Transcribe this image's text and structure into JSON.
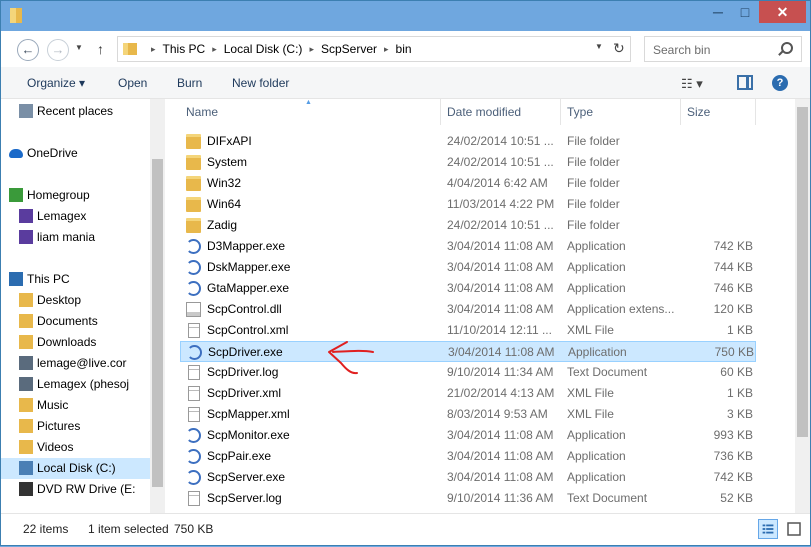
{
  "window": {
    "controls": {
      "minimize": "─",
      "maximize": "□",
      "close": "✕"
    }
  },
  "address": {
    "crumbs": [
      "This PC",
      "Local Disk (C:)",
      "ScpServer",
      "bin"
    ],
    "search_placeholder": "Search bin"
  },
  "toolbar": {
    "organize": "Organize ▾",
    "open": "Open",
    "burn": "Burn",
    "new_folder": "New folder",
    "view_options": "☷ ▾",
    "help": "?"
  },
  "nav": {
    "items": [
      {
        "label": "Recent places",
        "icon": "recent-places-icon"
      },
      {
        "label": "OneDrive",
        "icon": "onedrive-icon"
      },
      {
        "label": "Homegroup",
        "icon": "homegroup-icon"
      },
      {
        "label": "Lemagex",
        "icon": "user-icon"
      },
      {
        "label": "liam mania",
        "icon": "user-icon"
      },
      {
        "label": "This PC",
        "icon": "computer-icon"
      },
      {
        "label": "Desktop",
        "icon": "folder-icon"
      },
      {
        "label": "Documents",
        "icon": "folder-icon"
      },
      {
        "label": "Downloads",
        "icon": "folder-icon"
      },
      {
        "label": "lemage@live.cor",
        "icon": "network-pc-icon"
      },
      {
        "label": "Lemagex (phesoj",
        "icon": "network-pc-icon"
      },
      {
        "label": "Music",
        "icon": "folder-icon"
      },
      {
        "label": "Pictures",
        "icon": "folder-icon"
      },
      {
        "label": "Videos",
        "icon": "folder-icon"
      },
      {
        "label": "Local Disk (C:)",
        "icon": "drive-icon"
      },
      {
        "label": "DVD RW Drive (E:",
        "icon": "dvd-drive-icon"
      }
    ]
  },
  "columns": {
    "name": "Name",
    "date": "Date modified",
    "type": "Type",
    "size": "Size"
  },
  "files": [
    {
      "name": "DIFxAPI",
      "date": "24/02/2014 10:51 ...",
      "type": "File folder",
      "size": "",
      "icon": "folder"
    },
    {
      "name": "System",
      "date": "24/02/2014 10:51 ...",
      "type": "File folder",
      "size": "",
      "icon": "folder"
    },
    {
      "name": "Win32",
      "date": "4/04/2014 6:42 AM",
      "type": "File folder",
      "size": "",
      "icon": "folder"
    },
    {
      "name": "Win64",
      "date": "11/03/2014 4:22 PM",
      "type": "File folder",
      "size": "",
      "icon": "folder"
    },
    {
      "name": "Zadig",
      "date": "24/02/2014 10:51 ...",
      "type": "File folder",
      "size": "",
      "icon": "folder"
    },
    {
      "name": "D3Mapper.exe",
      "date": "3/04/2014 11:08 AM",
      "type": "Application",
      "size": "742 KB",
      "icon": "exe"
    },
    {
      "name": "DskMapper.exe",
      "date": "3/04/2014 11:08 AM",
      "type": "Application",
      "size": "744 KB",
      "icon": "exe"
    },
    {
      "name": "GtaMapper.exe",
      "date": "3/04/2014 11:08 AM",
      "type": "Application",
      "size": "746 KB",
      "icon": "exe"
    },
    {
      "name": "ScpControl.dll",
      "date": "3/04/2014 11:08 AM",
      "type": "Application extens...",
      "size": "120 KB",
      "icon": "dll"
    },
    {
      "name": "ScpControl.xml",
      "date": "11/10/2014 12:11 ...",
      "type": "XML File",
      "size": "1 KB",
      "icon": "doc"
    },
    {
      "name": "ScpDriver.exe",
      "date": "3/04/2014 11:08 AM",
      "type": "Application",
      "size": "750 KB",
      "icon": "exe",
      "selected": true
    },
    {
      "name": "ScpDriver.log",
      "date": "9/10/2014 11:34 AM",
      "type": "Text Document",
      "size": "60 KB",
      "icon": "doc"
    },
    {
      "name": "ScpDriver.xml",
      "date": "21/02/2014 4:13 AM",
      "type": "XML File",
      "size": "1 KB",
      "icon": "doc"
    },
    {
      "name": "ScpMapper.xml",
      "date": "8/03/2014 9:53 AM",
      "type": "XML File",
      "size": "3 KB",
      "icon": "doc"
    },
    {
      "name": "ScpMonitor.exe",
      "date": "3/04/2014 11:08 AM",
      "type": "Application",
      "size": "993 KB",
      "icon": "exe"
    },
    {
      "name": "ScpPair.exe",
      "date": "3/04/2014 11:08 AM",
      "type": "Application",
      "size": "736 KB",
      "icon": "exe"
    },
    {
      "name": "ScpServer.exe",
      "date": "3/04/2014 11:08 AM",
      "type": "Application",
      "size": "742 KB",
      "icon": "exe"
    },
    {
      "name": "ScpServer.log",
      "date": "9/10/2014 11:36 AM",
      "type": "Text Document",
      "size": "52 KB",
      "icon": "doc"
    }
  ],
  "status": {
    "count": "22 items",
    "selected": "1 item selected",
    "size": "750 KB"
  },
  "colors": {
    "selection": "#cce8ff",
    "annotation": "#e02020",
    "titlebar": "#6fa7df"
  }
}
